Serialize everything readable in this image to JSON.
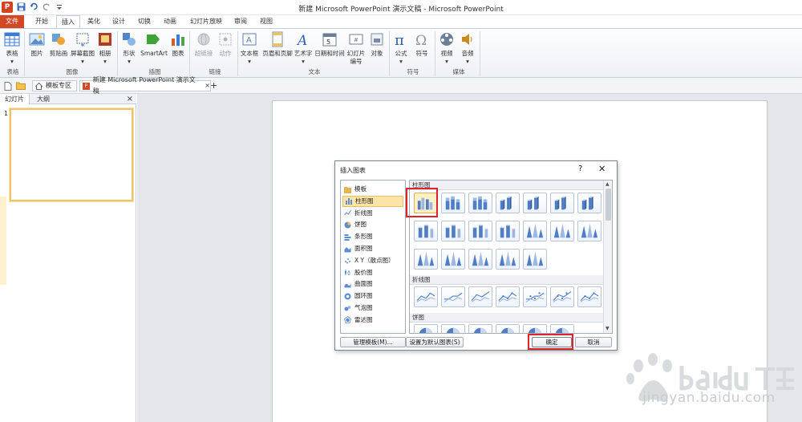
{
  "window": {
    "title": "新建 Microsoft PowerPoint 演示文稿 - Microsoft PowerPoint"
  },
  "qat": {
    "logo": "P"
  },
  "tabs": [
    {
      "label": "文件"
    },
    {
      "label": "开始"
    },
    {
      "label": "插入"
    },
    {
      "label": "美化"
    },
    {
      "label": "设计"
    },
    {
      "label": "切换"
    },
    {
      "label": "动画"
    },
    {
      "label": "幻灯片放映"
    },
    {
      "label": "审阅"
    },
    {
      "label": "视图"
    }
  ],
  "ribbon": {
    "buttons": [
      {
        "cap": "表格",
        "sub": "▾",
        "color": "#3a7bd5"
      },
      {
        "cap": "图片",
        "sub": "",
        "color": "#5b8fc9"
      },
      {
        "cap": "剪贴画",
        "sub": "",
        "color": "#6aa0d8"
      },
      {
        "cap": "屏幕截图",
        "sub": "▾",
        "color": "#4a76b0"
      },
      {
        "cap": "相册",
        "sub": "▾",
        "color": "#b23a2a"
      },
      {
        "cap": "形状",
        "sub": "▾",
        "color": "#4e86c8"
      },
      {
        "cap": "SmartArt",
        "sub": "",
        "color": "#3fa33a"
      },
      {
        "cap": "图表",
        "sub": "",
        "color": "#d55a2c"
      },
      {
        "cap": "超链接",
        "sub": "",
        "color": "#b0b6bd"
      },
      {
        "cap": "动作",
        "sub": "",
        "color": "#b0b6bd"
      },
      {
        "cap": "文本框",
        "sub": "▾",
        "color": "#5a7fb0"
      },
      {
        "cap": "页眉和页脚",
        "sub": "",
        "color": "#7e8a99"
      },
      {
        "cap": "艺术字",
        "sub": "▾",
        "color": "#2f61b3"
      },
      {
        "cap": "日期和时间",
        "sub": "",
        "color": "#6b7d95"
      },
      {
        "cap": "幻灯片",
        "sub": "编号",
        "color": "#6b7d95"
      },
      {
        "cap": "对象",
        "sub": "",
        "color": "#7a8aa0"
      },
      {
        "cap": "公式",
        "sub": "▾",
        "color": "#2b5ea8"
      },
      {
        "cap": "符号",
        "sub": "",
        "color": "#8d96a2"
      },
      {
        "cap": "视频",
        "sub": "▾",
        "color": "#6c7f96"
      },
      {
        "cap": "音频",
        "sub": "▾",
        "color": "#c98a1a"
      }
    ],
    "groups": [
      {
        "label": "表格"
      },
      {
        "label": "图像"
      },
      {
        "label": "插图"
      },
      {
        "label": "链接"
      },
      {
        "label": "文本"
      },
      {
        "label": "符号"
      },
      {
        "label": "媒体"
      }
    ]
  },
  "docbar": {
    "tabs": [
      {
        "label": "模板专区"
      },
      {
        "label": "新建 Microsoft PowerPoint 演示文稿"
      }
    ],
    "close_glyph": "×",
    "add_glyph": "+"
  },
  "leftpanel": {
    "tabs": [
      {
        "label": "幻灯片"
      },
      {
        "label": "大纲"
      }
    ],
    "close_glyph": "×",
    "slide_number": "1"
  },
  "dialog": {
    "title": "插入图表",
    "help_glyph": "?",
    "close_glyph": "✕",
    "categories": [
      {
        "label": "模板",
        "icon": "folder-icon",
        "color": "#e8b94a"
      },
      {
        "label": "柱形图",
        "icon": "column-chart-icon",
        "color": "#5b8ed6"
      },
      {
        "label": "折线图",
        "icon": "line-chart-icon",
        "color": "#5b8ed6"
      },
      {
        "label": "饼图",
        "icon": "pie-chart-icon",
        "color": "#5b8ed6"
      },
      {
        "label": "条形图",
        "icon": "bar-chart-icon",
        "color": "#5b8ed6"
      },
      {
        "label": "面积图",
        "icon": "area-chart-icon",
        "color": "#5b8ed6"
      },
      {
        "label": "X Y（散点图）",
        "icon": "scatter-chart-icon",
        "color": "#5b8ed6"
      },
      {
        "label": "股价图",
        "icon": "stock-chart-icon",
        "color": "#5b8ed6"
      },
      {
        "label": "曲面图",
        "icon": "surface-chart-icon",
        "color": "#5b8ed6"
      },
      {
        "label": "圆环图",
        "icon": "doughnut-chart-icon",
        "color": "#5b8ed6"
      },
      {
        "label": "气泡图",
        "icon": "bubble-chart-icon",
        "color": "#5b8ed6"
      },
      {
        "label": "雷达图",
        "icon": "radar-chart-icon",
        "color": "#5b8ed6"
      }
    ],
    "selected_category": 1,
    "sections": [
      {
        "label": "柱形图"
      },
      {
        "label": "折线图"
      },
      {
        "label": "饼图"
      }
    ],
    "buttons": {
      "manage": "管理模板(M)...",
      "set_default": "设置为默认图表(S)",
      "ok": "确定",
      "cancel": "取消"
    }
  },
  "watermark": {
    "text": "jingyan.baidu.com"
  },
  "colors": {
    "accent": "#d24726",
    "highlight": "#e1232b",
    "selection": "#fbe4a6"
  }
}
